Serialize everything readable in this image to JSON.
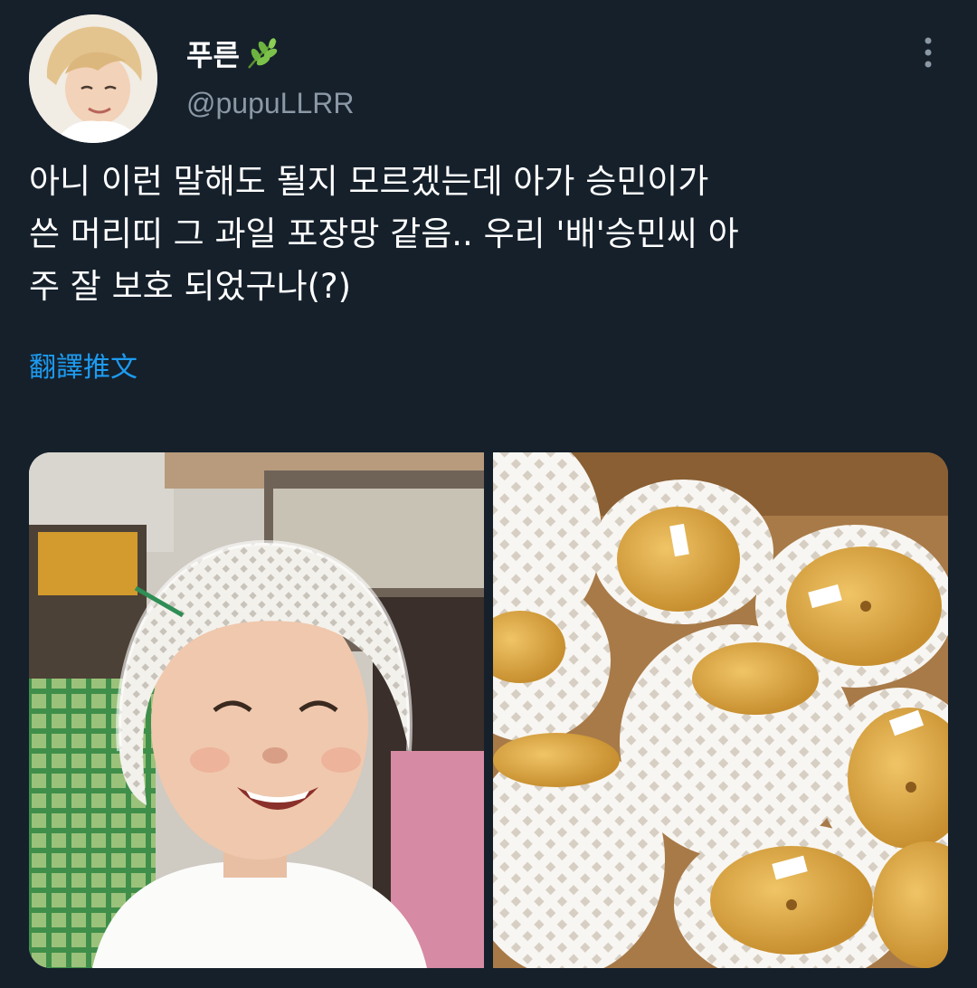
{
  "tweet": {
    "author": {
      "display_name": "푸른",
      "name_emoji": "herb-icon",
      "handle": "@pupuLLRR"
    },
    "text": "아니 이런 말해도 될지 모르겠는데 아가 승민이가\n쓴 머리띠 그 과일 포장망 같음.. 우리 '배'승민씨 아\n주 잘 보호 되었구나(?)",
    "translate_label": "翻譯推文",
    "more_icon": "more-vertical-icon"
  },
  "media": {
    "images": [
      {
        "name": "child-photo",
        "description_icon": "photo"
      },
      {
        "name": "pear-photo",
        "description_icon": "photo"
      }
    ]
  },
  "colors": {
    "background": "#15202b",
    "primary_text": "#ffffff",
    "secondary_text": "#8b98a5",
    "link": "#1d9bf0"
  }
}
